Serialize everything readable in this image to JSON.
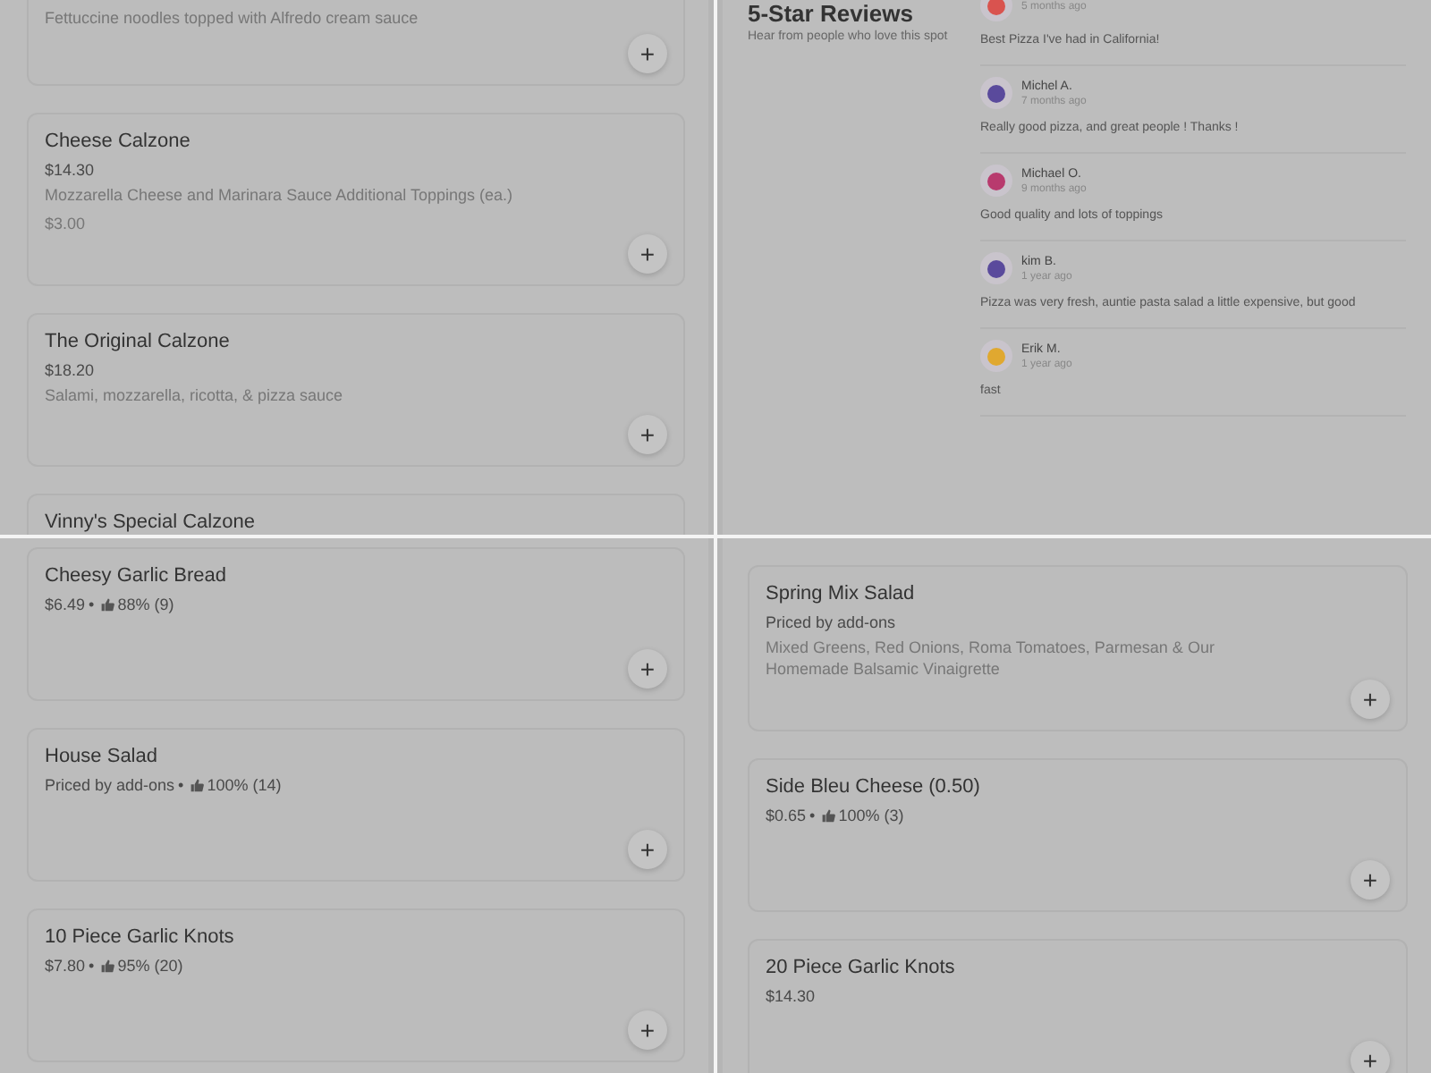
{
  "panels": [
    {
      "kind": "menu",
      "items": [
        {
          "description": "Fettuccine noodles topped with Alfredo cream sauce",
          "add": "+"
        },
        {
          "title": "Cheese Calzone",
          "price": "$14.30",
          "description": "Mozzarella Cheese and Marinara Sauce Additional Toppings (ea.)",
          "extra": "$3.00",
          "add": "+"
        },
        {
          "title": "The Original Calzone",
          "price": "$18.20",
          "description": "Salami, mozzarella, ricotta, & pizza sauce",
          "add": "+"
        },
        {
          "title": "Vinny's Special Calzone"
        }
      ]
    },
    {
      "kind": "reviews",
      "title": "5-Star Reviews",
      "subtitle": "Hear from people who love this spot",
      "reviews": [
        {
          "time": "5 months ago",
          "text": "Best Pizza I've had in California!",
          "color": "#d9534f"
        },
        {
          "name": "Michel A.",
          "time": "7 months ago",
          "text": "Really good pizza, and great people ! Thanks !",
          "color": "#5a4a9c"
        },
        {
          "name": "Michael O.",
          "time": "9 months ago",
          "text": "Good quality and lots of toppings",
          "color": "#b83a6e"
        },
        {
          "name": "kim B.",
          "time": "1 year ago",
          "text": "Pizza was very fresh, auntie pasta salad a little expensive, but good",
          "color": "#5a4a9c"
        },
        {
          "name": "Erik M.",
          "time": "1 year ago",
          "text": "fast",
          "color": "#e0a830"
        }
      ]
    },
    {
      "kind": "menu",
      "items": [
        {
          "title": "Cheesy Garlic Bread",
          "price": "$6.49",
          "separator": "•",
          "rating": "88% (9)",
          "add": "+"
        },
        {
          "title": "House Salad",
          "price": "Priced by add-ons",
          "separator": "•",
          "rating": "100% (14)",
          "add": "+"
        },
        {
          "title": "10 Piece Garlic Knots",
          "price": "$7.80",
          "separator": "•",
          "rating": "95% (20)",
          "add": "+"
        }
      ]
    },
    {
      "kind": "menu",
      "items": [
        {
          "title": "Spring Mix Salad",
          "price": "Priced by add-ons",
          "description": "Mixed Greens, Red Onions, Roma Tomatoes, Parmesan & Our Homemade Balsamic Vinaigrette",
          "add": "+"
        },
        {
          "title": "Side Bleu Cheese (0.50)",
          "price": "$0.65",
          "separator": "•",
          "rating": "100% (3)",
          "add": "+"
        },
        {
          "title": "20 Piece Garlic Knots",
          "price": "$14.30",
          "add": "+"
        }
      ]
    }
  ]
}
